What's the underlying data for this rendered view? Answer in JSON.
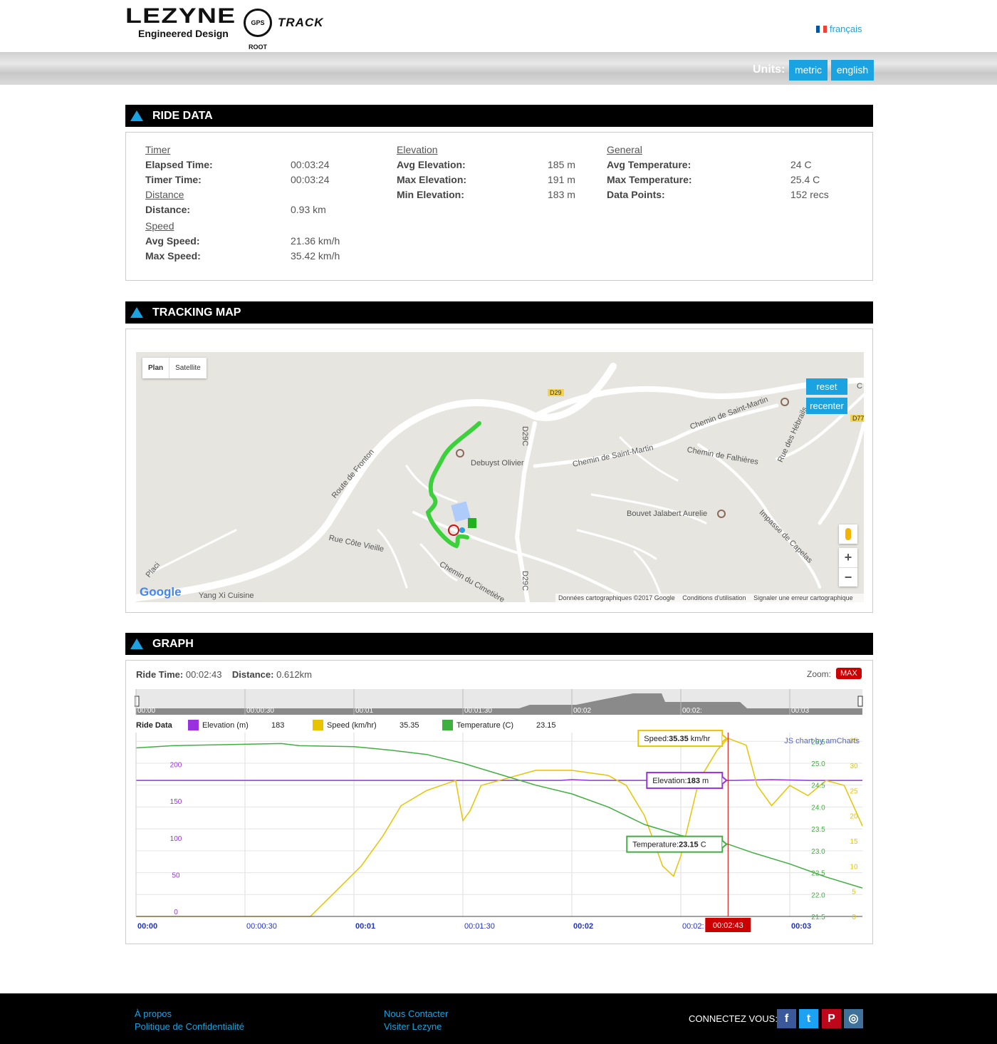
{
  "header": {
    "brand": "LEZYNE",
    "tagline": "Engineered Design",
    "badge": "GPS ROOT",
    "product": "TRACK",
    "language": "français",
    "units_label": "Units:",
    "unit_metric": "metric",
    "unit_english": "english"
  },
  "ride_section": {
    "title": "RIDE DATA",
    "timer": {
      "heading": "Timer",
      "elapsed_k": "Elapsed Time:",
      "elapsed_v": "00:03:24",
      "timer_k": "Timer Time:",
      "timer_v": "00:03:24"
    },
    "distance": {
      "heading": "Distance",
      "dist_k": "Distance:",
      "dist_v": "0.93 km"
    },
    "speed": {
      "heading": "Speed",
      "avg_k": "Avg Speed:",
      "avg_v": "21.36 km/h",
      "max_k": "Max Speed:",
      "max_v": "35.42 km/h"
    },
    "elevation": {
      "heading": "Elevation",
      "avg_k": "Avg Elevation:",
      "avg_v": "185 m",
      "max_k": "Max Elevation:",
      "max_v": "191 m",
      "min_k": "Min Elevation:",
      "min_v": "183 m"
    },
    "general": {
      "heading": "General",
      "avgt_k": "Avg Temperature:",
      "avgt_v": "24 C",
      "maxt_k": "Max Temperature:",
      "maxt_v": "25.4 C",
      "dp_k": "Data Points:",
      "dp_v": "152 recs"
    }
  },
  "map_section": {
    "title": "TRACKING MAP",
    "toggle_plan": "Plan",
    "toggle_satellite": "Satellite",
    "reset": "reset",
    "recenter": "recenter",
    "zoom_in": "+",
    "zoom_out": "−",
    "google": "Google",
    "footer_data": "Données cartographiques ©2017 Google",
    "footer_terms": "Conditions d'utilisation",
    "footer_report": "Signaler une erreur cartographique",
    "labels": {
      "d29": "D29",
      "d77": "D77",
      "d29c_top": "D29C",
      "d29c_bottom": "D29C",
      "route_fronton": "Route de Fronton",
      "debuyst": "Debuyst Olivier",
      "saint_martin_1": "Chemin de Saint-Martin",
      "saint_martin_2": "Chemin de Saint-Martin",
      "falhieres": "Chemin de Falhières",
      "hebrails": "Rue des Hébrails",
      "bouvet": "Bouvet Jalabert Aurelie",
      "capelas": "Impasse de Capelas",
      "cote_vieille": "Rue Côte Vieille",
      "cimetiere": "Chemin du Cimetière",
      "placi": "Placi",
      "yang": "Yang Xi Cuisine",
      "edge_c": "C"
    }
  },
  "graph_section": {
    "title": "GRAPH",
    "ride_time_k": "Ride Time:",
    "ride_time_v": "00:02:43",
    "distance_k": "Distance:",
    "distance_v": "0.612km",
    "zoom_label": "Zoom:",
    "zoom_value": "MAX"
  },
  "chart_data": {
    "type": "line",
    "credit": "JS chart by amCharts",
    "legend_title": "Ride Data",
    "x_labels": [
      "00:00",
      "00:00:30",
      "00:01",
      "00:01:30",
      "00:02",
      "00:02:",
      "00:03"
    ],
    "cursor_label": "00:02:43",
    "cursor_x_seconds": 163,
    "x_range_seconds": [
      0,
      200
    ],
    "left_axis": {
      "ticks": [
        "0",
        "50",
        "100",
        "150",
        "200"
      ],
      "ylim": [
        0,
        250
      ],
      "color": "#9b30e0"
    },
    "right_axis_temp": {
      "ticks": [
        "21.5",
        "22.0",
        "22.5",
        "23.0",
        "23.5",
        "24.0",
        "24.5",
        "25.0",
        "25.5"
      ],
      "ylim": [
        21.5,
        25.7
      ],
      "color": "#3fb03f"
    },
    "right_axis_speed": {
      "ticks": [
        "0",
        "5",
        "10",
        "15",
        "20",
        "25",
        "30",
        "35"
      ],
      "ylim": [
        0,
        36.5
      ],
      "color": "#e8c400"
    },
    "series": [
      {
        "name": "Elevation (m)",
        "legend_value": "183",
        "color": "#9b30e0",
        "balloon_label": "Elevation:",
        "balloon_value": "183",
        "balloon_unit": " m",
        "x": [
          0,
          60,
          90,
          117,
          120,
          125,
          140,
          165,
          175,
          185,
          200
        ],
        "y": [
          185,
          185,
          185,
          185,
          186,
          185,
          185,
          185,
          186,
          185,
          185
        ]
      },
      {
        "name": "Speed (km/hr)",
        "legend_value": "35.35",
        "color": "#e8c400",
        "balloon_label": "Speed:",
        "balloon_value": "35.35",
        "balloon_unit": " km/hr",
        "x": [
          0,
          48,
          55,
          62,
          65,
          68,
          73,
          80,
          88,
          90,
          92,
          95,
          100,
          110,
          120,
          130,
          135,
          140,
          143,
          145,
          148,
          150,
          155,
          160,
          163,
          168,
          171,
          175,
          180,
          185,
          190,
          195,
          200
        ],
        "y": [
          0,
          0,
          5,
          10,
          13,
          16,
          22,
          25,
          27,
          19,
          21,
          26,
          27,
          29,
          29,
          28,
          26,
          20,
          14,
          10,
          8,
          12,
          27,
          33,
          35.35,
          34,
          26,
          22,
          26,
          24,
          27,
          26,
          18
        ]
      },
      {
        "name": "Temperature (C)",
        "legend_value": "23.15",
        "color": "#3fb03f",
        "balloon_label": "Temperature:",
        "balloon_value": "23.15",
        "balloon_unit": " C",
        "x": [
          0,
          10,
          40,
          45,
          60,
          70,
          80,
          90,
          100,
          110,
          120,
          130,
          140,
          150,
          160,
          163,
          170,
          180,
          190,
          200
        ],
        "y": [
          25.35,
          25.4,
          25.45,
          25.4,
          25.38,
          25.3,
          25.2,
          25.0,
          24.75,
          24.5,
          24.3,
          24.0,
          23.6,
          23.35,
          23.2,
          23.15,
          22.95,
          22.7,
          22.4,
          22.15
        ]
      }
    ]
  },
  "footer": {
    "about": "À propos",
    "privacy": "Politique de Confidentialité",
    "contact": "Nous Contacter",
    "visit": "Visiter Lezyne",
    "connect": "CONNECTEZ VOUS:"
  }
}
